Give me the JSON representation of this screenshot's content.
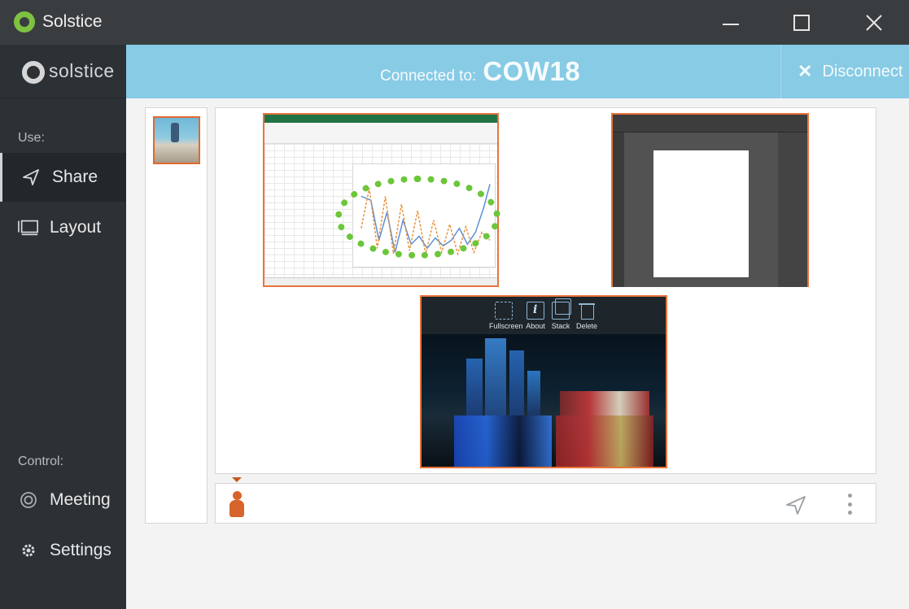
{
  "window": {
    "title": "Solstice"
  },
  "sidebar": {
    "logo_text": "solstice",
    "use_label": "Use:",
    "control_label": "Control:",
    "items": [
      {
        "label": "Share",
        "icon": "send-icon"
      },
      {
        "label": "Layout",
        "icon": "monitor-icon"
      },
      {
        "label": "Meeting",
        "icon": "target-icon"
      },
      {
        "label": "Settings",
        "icon": "gear-icon"
      }
    ]
  },
  "header": {
    "connected_prefix": "Connected to:",
    "room_name": "COW18",
    "disconnect_label": "Disconnect"
  },
  "post_toolbar": {
    "fullscreen_label": "Fullscreen",
    "about_label": "About",
    "stack_label": "Stack",
    "delete_label": "Delete"
  },
  "colors": {
    "header_bg": "#87cbe5",
    "sidebar_bg": "#2c3135",
    "titlebar_bg": "#3a3d40",
    "post_border": "#e8743b",
    "presenter": "#d7642a",
    "highlight": "#6cc63a"
  }
}
